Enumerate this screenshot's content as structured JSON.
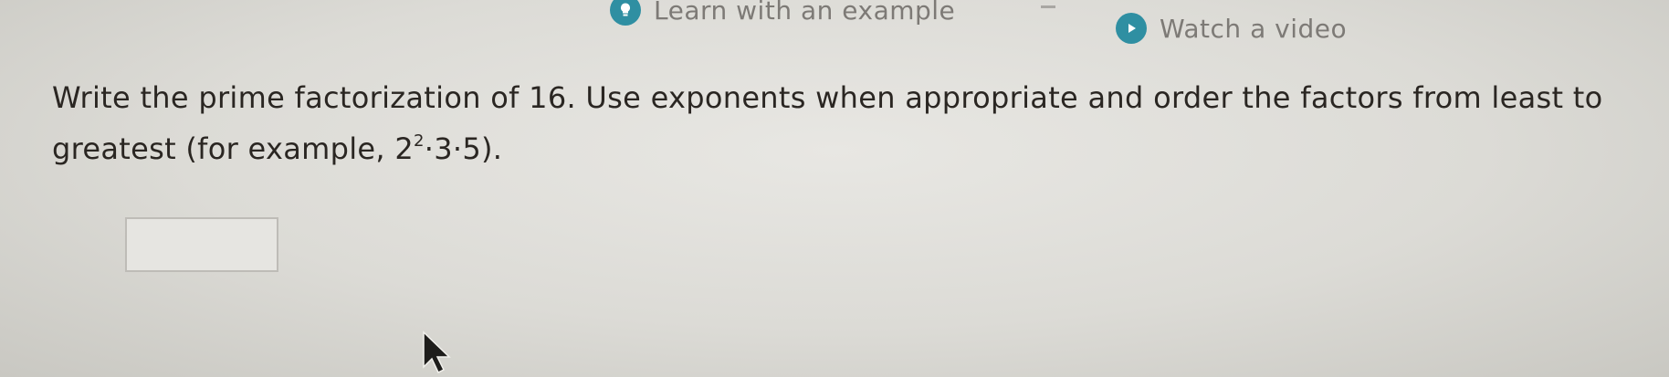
{
  "links": {
    "example_icon": "lightbulb-icon",
    "example_label": "Learn with an example",
    "video_icon": "play-icon",
    "video_label": "Watch a video"
  },
  "question": {
    "text": "Write the prime factorization of 16. Use exponents when appropriate and order the factors from least to greatest (for example, ",
    "ex_base": "2",
    "ex_exp": "2",
    "ex_rest": "·3·5)."
  },
  "answer": {
    "value": ""
  },
  "colors": {
    "accent": "#2f8fa2",
    "text": "#2a2622",
    "link_text": "#7d7a76"
  }
}
